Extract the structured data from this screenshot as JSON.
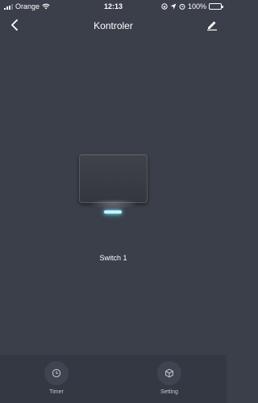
{
  "status_bar": {
    "carrier": "Orange",
    "time": "12:13",
    "battery": "100%"
  },
  "nav": {
    "title": "Kontroler"
  },
  "switch": {
    "label": "Switch 1"
  },
  "tabs": [
    {
      "label": "Timer",
      "icon": "clock-icon"
    },
    {
      "label": "Setting",
      "icon": "cube-icon"
    }
  ],
  "colors": {
    "background": "#3a3f4a",
    "bottom_bar": "#333842",
    "indicator": "#bff3ff"
  }
}
